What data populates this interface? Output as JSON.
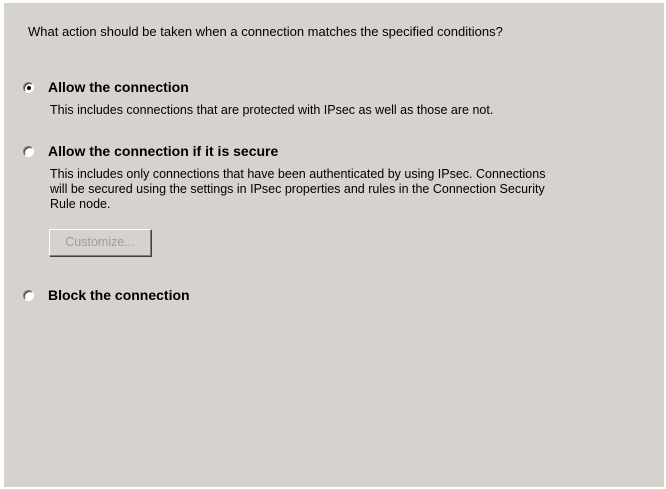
{
  "question": "What action should be taken when a connection matches the specified conditions?",
  "options": [
    {
      "label": "Allow the connection",
      "checked": true,
      "description": [
        "This includes connections that are protected with IPsec as well as those are not."
      ]
    },
    {
      "label": "Allow the connection if it is secure",
      "checked": false,
      "description": [
        "This includes only connections that have been authenticated by using IPsec.  Connections",
        "will be secured using the settings in IPsec properties and rules in the Connection Security",
        "Rule node."
      ],
      "button_label": "Customize...",
      "button_enabled": false
    },
    {
      "label": "Block the connection",
      "checked": false
    }
  ]
}
